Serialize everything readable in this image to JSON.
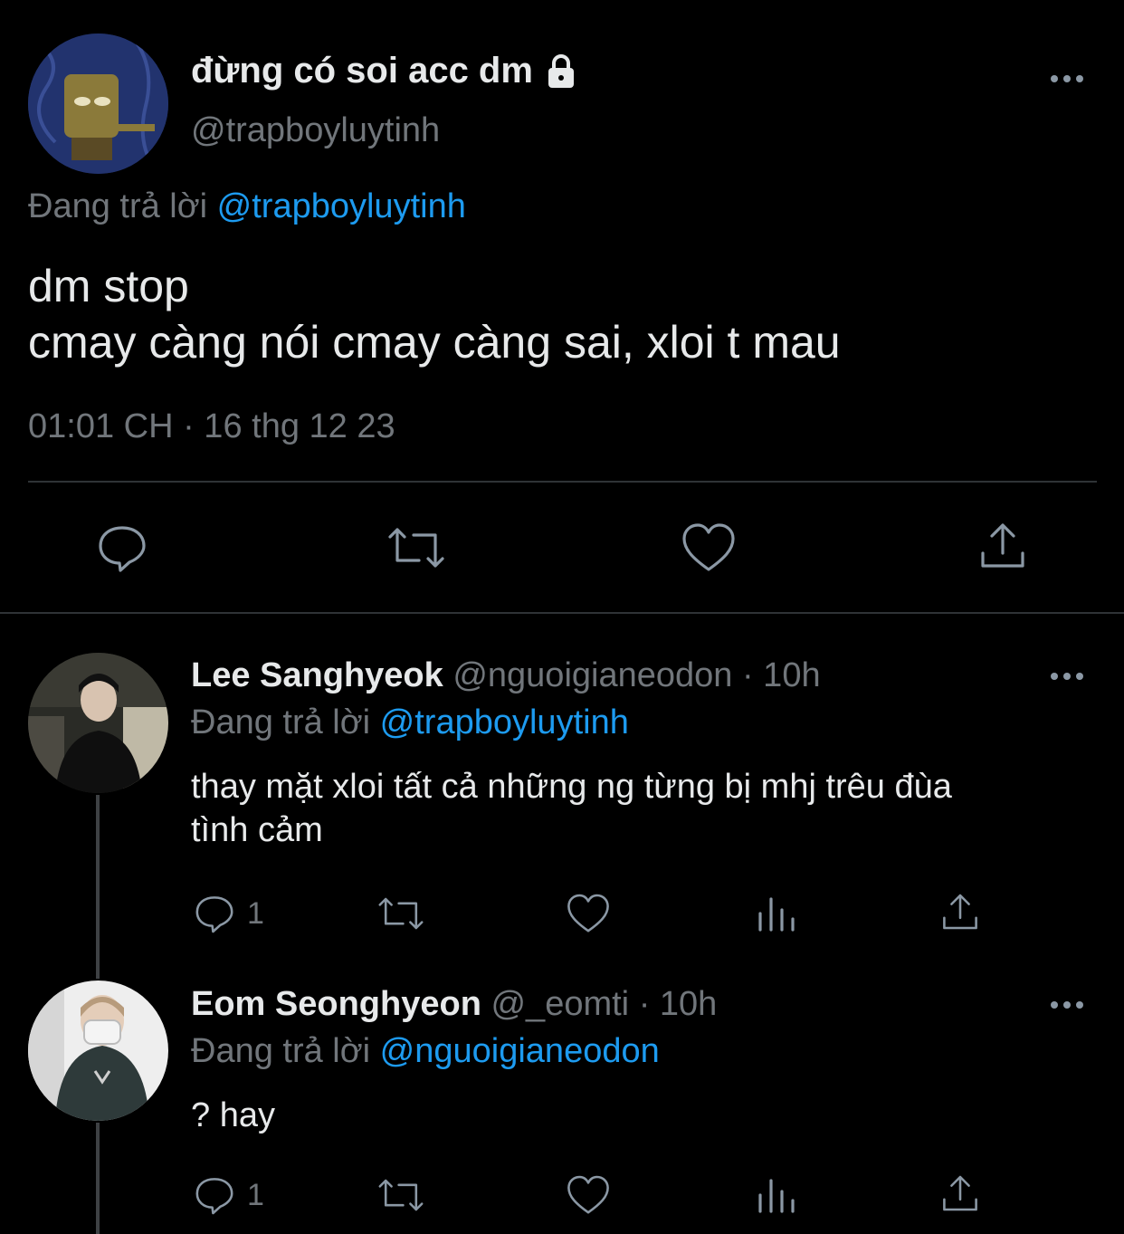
{
  "main_tweet": {
    "display_name": "đừng có soi acc dm",
    "handle": "@trapboyluytinh",
    "reply_prefix": "Đang trả lời",
    "reply_to": "@trapboyluytinh",
    "text_line1": "dm stop",
    "text_line2": "cmay càng nói cmay càng sai, xloi t mau",
    "timestamp": "01:01 CH · 16 thg 12 23",
    "locked": true
  },
  "replies": [
    {
      "display_name": "Lee Sanghyeok",
      "handle": "@nguoigianeodon",
      "time": "· 10h",
      "reply_prefix": "Đang trả lời",
      "reply_to": "@trapboyluytinh",
      "text_line1": "thay mặt xloi tất cả những ng từng bị mhj trêu đùa",
      "text_line2": "tình cảm",
      "reply_count": "1"
    },
    {
      "display_name": "Eom Seonghyeon",
      "handle": "@_eomti",
      "time": "· 10h",
      "reply_prefix": "Đang trả lời",
      "reply_to": "@nguoigianeodon",
      "text_line1": "? hay",
      "reply_count": "1"
    }
  ],
  "colors": {
    "background": "#000000",
    "text": "#e7e9ea",
    "muted": "#71767b",
    "link": "#1d9bf0",
    "icon": "#8b98a5"
  },
  "icons": [
    "more-icon",
    "lock-icon",
    "reply-icon",
    "retweet-icon",
    "like-icon",
    "share-icon",
    "views-icon"
  ]
}
